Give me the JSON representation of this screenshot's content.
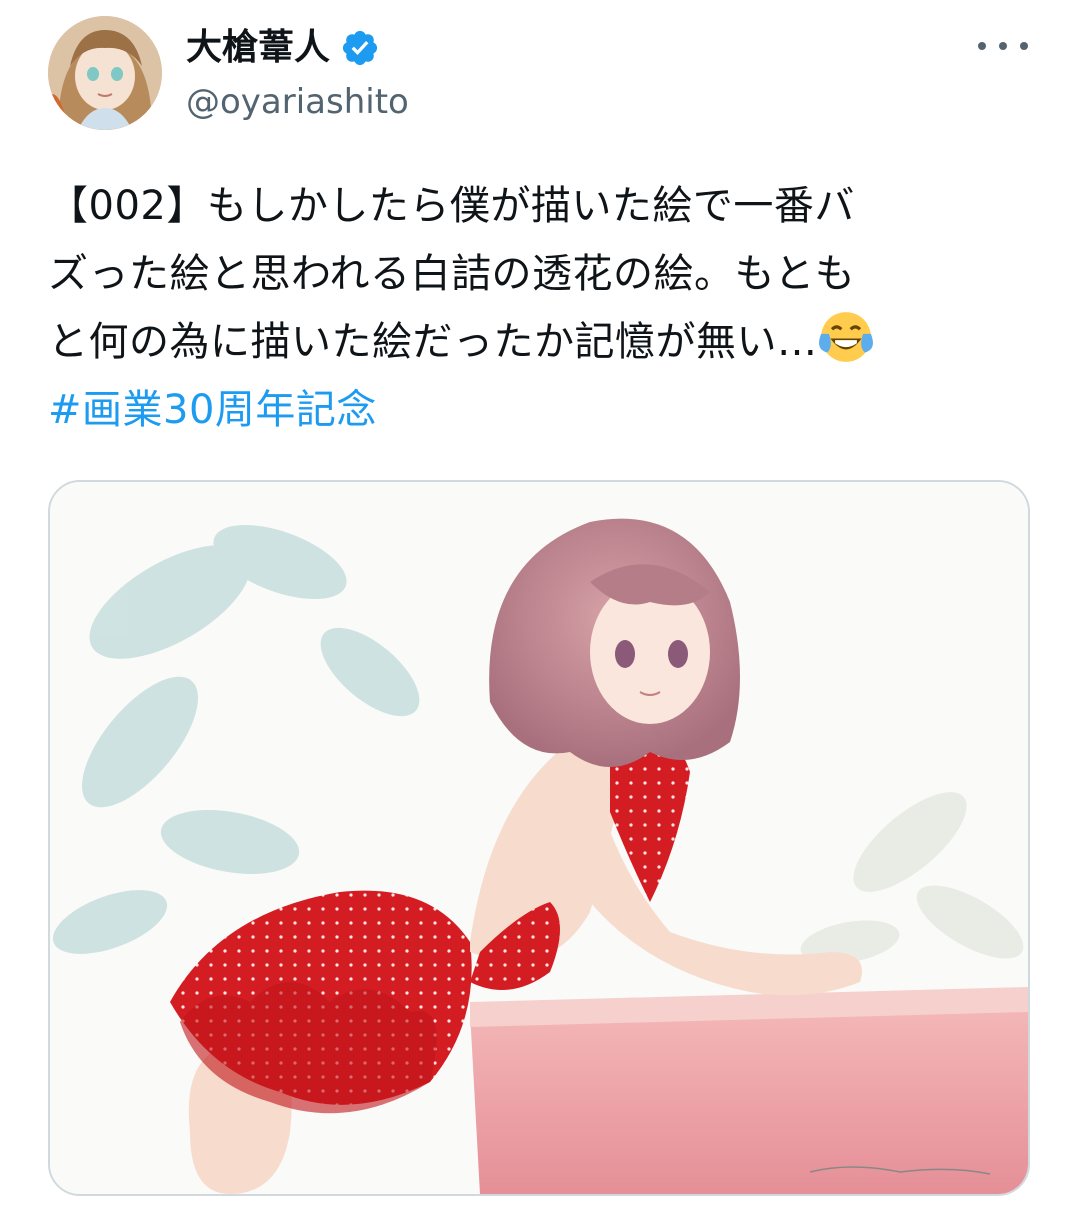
{
  "author": {
    "display_name": "大槍葦人",
    "handle": "@oyariashito",
    "verified_icon": "verified-badge-icon",
    "avatar_icon": "avatar-illustration"
  },
  "menu": {
    "icon": "more-horizontal-icon"
  },
  "tweet": {
    "lines": [
      "【002】もしかしたら僕が描いた絵で一番バ",
      "ズった絵と思われる白詰の透花の絵。もとも",
      "と何の為に描いた絵だったか記憶が無い…"
    ],
    "emoji": "face-with-tears-of-joy-icon",
    "hashtag": "#画業30周年記念"
  },
  "media": {
    "type": "illustration",
    "description_icon": "girl-red-polka-dot-dress-illustration"
  },
  "colors": {
    "text": "#0f1419",
    "secondary": "#536471",
    "link": "#1d9bf0",
    "verified": "#1d9bf0",
    "border": "#cfd9de"
  }
}
